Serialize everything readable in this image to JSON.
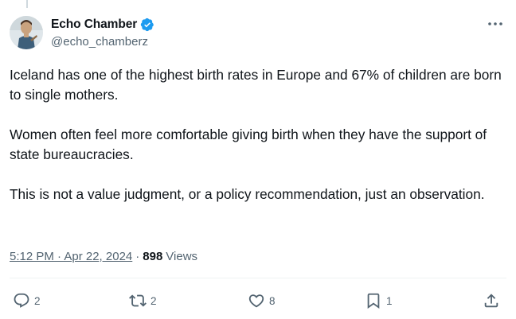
{
  "author": {
    "display_name": "Echo Chamber",
    "handle": "@echo_chamberz",
    "verified": true,
    "avatar": "profile-photo"
  },
  "tweet": {
    "paragraphs": [
      "Iceland has one of the highest birth rates in Europe and 67% of children are born to single mothers.",
      "Women often feel more comfortable giving birth when they have the support of state bureaucracies.",
      "This is not a value judgment, or a policy recommendation, just an observation."
    ]
  },
  "meta": {
    "time": "5:12 PM",
    "separator": "·",
    "date": "Apr 22, 2024",
    "timestamp": "5:12 PM · Apr 22, 2024",
    "views_count": "898",
    "views_label": "Views"
  },
  "actions": {
    "reply_count": "2",
    "repost_count": "2",
    "like_count": "8",
    "bookmark_count": "1",
    "icons": [
      "reply-icon",
      "repost-icon",
      "like-icon",
      "bookmark-icon",
      "share-icon"
    ]
  },
  "colors": {
    "primary_text": "#0f1419",
    "secondary_text": "#536471",
    "verified_blue": "#1d9bf0",
    "divider": "#eff3f4"
  }
}
